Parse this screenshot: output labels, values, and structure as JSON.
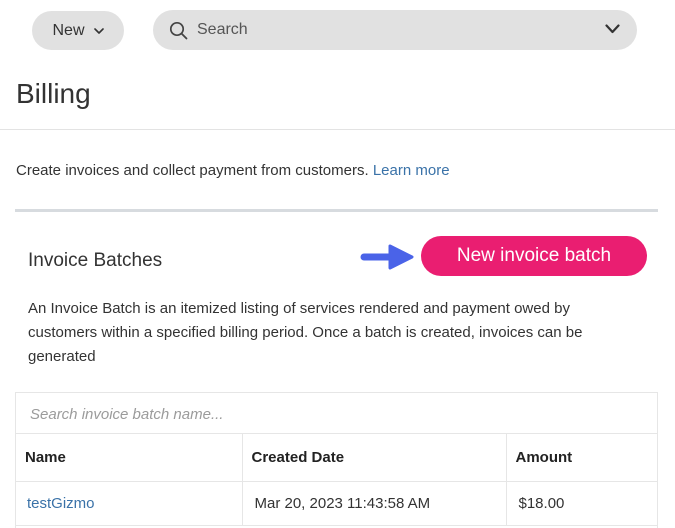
{
  "topbar": {
    "new_label": "New",
    "search_placeholder": "Search"
  },
  "page": {
    "title": "Billing",
    "intro_text": "Create invoices and collect payment from customers.",
    "learn_more": "Learn more"
  },
  "invoice_batches": {
    "title": "Invoice Batches",
    "new_button_label": "New invoice batch",
    "description": "An Invoice Batch is an itemized listing of services rendered and payment owed by customers within a specified billing period. Once a batch is created, invoices can be generated",
    "search_placeholder": "Search invoice batch name...",
    "columns": [
      "Name",
      "Created Date",
      "Amount"
    ],
    "rows": [
      {
        "name": "testGizmo",
        "created_date": "Mar 20, 2023 11:43:58 AM",
        "amount": "$18.00"
      }
    ]
  },
  "colors": {
    "primary_button": "#ea1e71",
    "link": "#3a72a8",
    "arrow": "#4a63e8",
    "pill_bg": "#e1e1e1"
  },
  "icons": [
    "chevron-down-icon",
    "search-icon",
    "arrow-right-icon"
  ]
}
